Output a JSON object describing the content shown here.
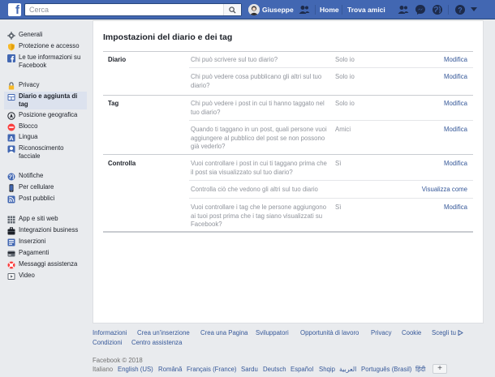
{
  "topbar": {
    "search_placeholder": "Cerca",
    "user_name": "Giuseppe",
    "home": "Home",
    "find_friends": "Trova amici"
  },
  "colors": {
    "brand": "#4267b2",
    "link": "#365899",
    "page_bg": "#e9ebee"
  },
  "sidebar": {
    "groups": [
      [
        {
          "label": "Generali",
          "icon": "gear-icon"
        },
        {
          "label": "Protezione e accesso",
          "icon": "shield-icon"
        },
        {
          "label": "Le tue informazioni su Facebook",
          "icon": "facebook-icon"
        }
      ],
      [
        {
          "label": "Privacy",
          "icon": "lock-icon"
        },
        {
          "label": "Diario e aggiunta di tag",
          "icon": "timeline-icon",
          "active": true
        },
        {
          "label": "Posizione geografica",
          "icon": "location-icon"
        },
        {
          "label": "Blocco",
          "icon": "block-icon"
        },
        {
          "label": "Lingua",
          "icon": "language-icon"
        },
        {
          "label": "Riconoscimento facciale",
          "icon": "face-icon"
        }
      ],
      [
        {
          "label": "Notifiche",
          "icon": "globe-icon"
        },
        {
          "label": "Per cellulare",
          "icon": "mobile-icon"
        },
        {
          "label": "Post pubblici",
          "icon": "rss-icon"
        }
      ],
      [
        {
          "label": "App e siti web",
          "icon": "apps-icon"
        },
        {
          "label": "Integrazioni business",
          "icon": "business-icon"
        },
        {
          "label": "Inserzioni",
          "icon": "ads-icon"
        },
        {
          "label": "Pagamenti",
          "icon": "payment-icon"
        },
        {
          "label": "Messaggi assistenza",
          "icon": "support-icon"
        },
        {
          "label": "Video",
          "icon": "video-icon"
        }
      ]
    ]
  },
  "main": {
    "title": "Impostazioni del diario e dei tag",
    "sections": [
      {
        "label": "Diario",
        "rows": [
          {
            "question": "Chi può scrivere sul tuo diario?",
            "value": "Solo io",
            "action": "Modifica"
          },
          {
            "question": "Chi può vedere cosa pubblicano gli altri sul tuo diario?",
            "value": "Solo io",
            "action": "Modifica"
          }
        ]
      },
      {
        "label": "Tag",
        "rows": [
          {
            "question": "Chi può vedere i post in cui ti hanno taggato nel tuo diario?",
            "value": "Solo io",
            "action": "Modifica"
          },
          {
            "question": "Quando ti taggano in un post, quali persone vuoi aggiungere al pubblico del post se non possono già vederlo?",
            "value": "Amici",
            "action": "Modifica"
          }
        ]
      },
      {
        "label": "Controlla",
        "rows": [
          {
            "question": "Vuoi controllare i post in cui ti taggano prima che il post sia visualizzato sul tuo diario?",
            "value": "Sì",
            "action": "Modifica"
          },
          {
            "question": "Controlla ciò che vedono gli altri sul tuo diario",
            "value": "",
            "action": "Visualizza come"
          },
          {
            "question": "Vuoi controllare i tag che le persone aggiungono ai tuoi post prima che i tag siano visualizzati su Facebook?",
            "value": "Sì",
            "action": "Modifica"
          }
        ]
      }
    ]
  },
  "footer": {
    "links": [
      "Informazioni",
      "Crea un'inserzione",
      "Crea una Pagina",
      "Sviluppatori",
      "Opportunità di lavoro",
      "Privacy",
      "Cookie",
      "Scegli tu",
      "Condizioni",
      "Centro assistenza"
    ],
    "copyright": "Facebook © 2018",
    "languages": [
      "Italiano",
      "English (US)",
      "Română",
      "Français (France)",
      "Sardu",
      "Deutsch",
      "Español",
      "Shqip",
      "العربية",
      "Português (Brasil)",
      "हिंदी"
    ],
    "more_languages": "+"
  }
}
